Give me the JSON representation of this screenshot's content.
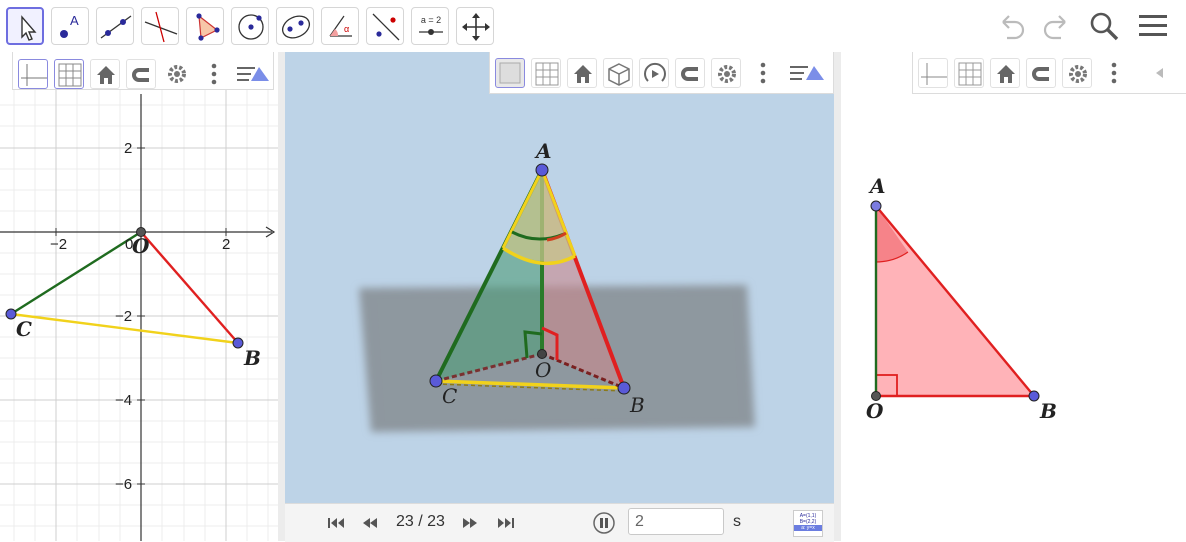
{
  "toolbar": {
    "tools": [
      {
        "name": "move-tool-button",
        "icon": "cursor-icon"
      },
      {
        "name": "point-tool-button",
        "icon": "point-A-icon",
        "label": "A"
      },
      {
        "name": "line-tool-button",
        "icon": "line-icon"
      },
      {
        "name": "perpendicular-tool-button",
        "icon": "perpendicular-icon"
      },
      {
        "name": "polygon-tool-button",
        "icon": "polygon-icon"
      },
      {
        "name": "circle-tool-button",
        "icon": "circle-icon"
      },
      {
        "name": "conic-tool-button",
        "icon": "ellipse-icon"
      },
      {
        "name": "angle-tool-button",
        "icon": "angle-icon",
        "label": "α"
      },
      {
        "name": "reflect-tool-button",
        "icon": "reflect-icon"
      },
      {
        "name": "slider-tool-button",
        "icon": "slider-icon",
        "label": "a = 2"
      },
      {
        "name": "move-view-tool-button",
        "icon": "move-graphics-icon"
      }
    ],
    "right_icons": [
      "undo-icon",
      "redo-icon",
      "search-icon",
      "hamburger-menu-icon"
    ]
  },
  "graphics2d": {
    "x_ticks": [
      "−2",
      "0",
      "2"
    ],
    "y_ticks": [
      "2",
      "−2",
      "−4",
      "−6"
    ],
    "points": {
      "O": "O",
      "C": "C",
      "B": "B"
    },
    "colors": {
      "OC": "#1f6b1f",
      "OB": "#e02020",
      "CB": "#f1d21b",
      "point": "#5a5ad8"
    }
  },
  "graphics3d": {
    "points": {
      "A": "A",
      "O": "O",
      "B": "B",
      "C": "C"
    },
    "background": "#bdd3e7"
  },
  "triangle_view": {
    "points": {
      "A": "A",
      "O": "O",
      "B": "B"
    },
    "fill": "#ffb3b8",
    "edge": "#e02020"
  },
  "animation_bar": {
    "step_display": "23 / 23",
    "speed_value": "2",
    "speed_unit": "s",
    "algebra_table": [
      "A=(1,1)",
      "B=(2,2)",
      "a: y=x"
    ]
  }
}
